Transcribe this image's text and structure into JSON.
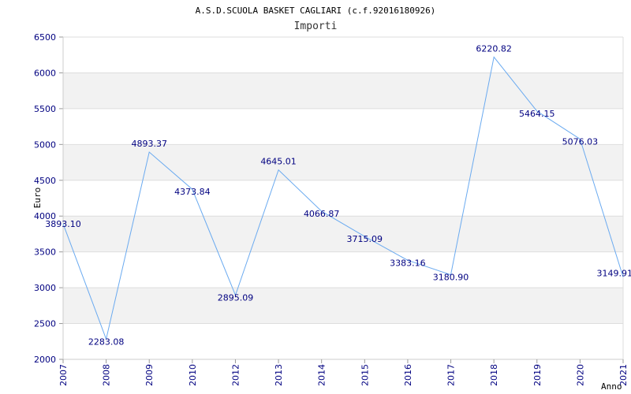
{
  "chart_data": {
    "type": "line",
    "title": "A.S.D.SCUOLA BASKET CAGLIARI (c.f.92016180926)",
    "subtitle": "Importi",
    "xlabel": "Anno",
    "ylabel": "Euro",
    "x": [
      "2007",
      "2008",
      "2009",
      "2010",
      "2012",
      "2013",
      "2014",
      "2015",
      "2016",
      "2017",
      "2018",
      "2019",
      "2020",
      "2021"
    ],
    "values": [
      3893.1,
      2283.08,
      4893.37,
      4373.84,
      2895.09,
      4645.01,
      4066.87,
      3715.09,
      3383.16,
      3180.9,
      6220.82,
      5464.15,
      5076.03,
      3149.91
    ],
    "value_labels": [
      "3893.10",
      "2283.08",
      "4893.37",
      "4373.84",
      "2895.09",
      "4645.01",
      "4066.87",
      "3715.09",
      "3383.16",
      "3180.90",
      "6220.82",
      "5464.15",
      "5076.03",
      "3149.91"
    ],
    "yticks": [
      "2000",
      "2500",
      "3000",
      "3500",
      "4000",
      "4500",
      "5000",
      "5500",
      "6000",
      "6500"
    ],
    "ylim": [
      2000,
      6500
    ],
    "grid": true,
    "colors": {
      "line": "#6aaaf0",
      "label": "#000080",
      "band": "#f2f2f2",
      "grid": "#dddddd"
    }
  }
}
